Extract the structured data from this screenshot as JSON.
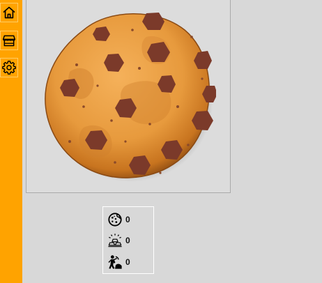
{
  "sidebar": {
    "items": [
      {
        "name": "home",
        "icon": "home-icon"
      },
      {
        "name": "shop",
        "icon": "shop-icon"
      },
      {
        "name": "settings",
        "icon": "gear-icon"
      }
    ],
    "color": "#ffa300"
  },
  "cookie": {
    "icon": "cookie-icon"
  },
  "stats": {
    "cookies": {
      "icon": "cookie-count-icon",
      "value": "0"
    },
    "gold": {
      "icon": "gold-bars-icon",
      "value": "0"
    },
    "workers": {
      "icon": "miner-icon",
      "value": "0"
    }
  }
}
